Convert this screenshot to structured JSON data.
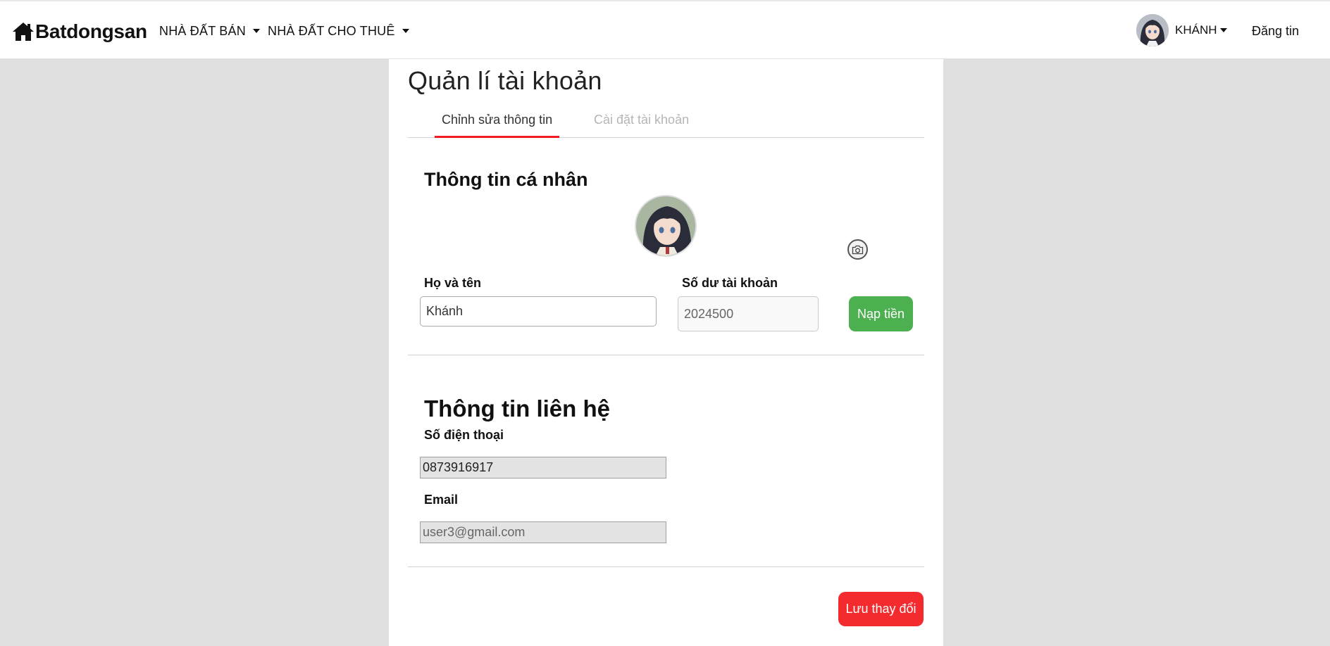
{
  "navbar": {
    "brand": "Batdongsan",
    "menu_sale": "NHÀ ĐẤT BÁN",
    "menu_rent": "NHÀ ĐẤT CHO THUÊ",
    "user_name": "KHÁNH",
    "post_label": "Đăng tin"
  },
  "page": {
    "title": "Quản lí tài khoản",
    "tabs": [
      {
        "label": "Chỉnh sửa thông tin",
        "active": true
      },
      {
        "label": "Cài đặt tài khoản",
        "active": false
      }
    ]
  },
  "personal": {
    "title": "Thông tin cá nhân",
    "name_label": "Họ và tên",
    "name_value": "Khánh",
    "balance_label": "Số dư tài khoản",
    "balance_value": "2024500",
    "topup_label": "Nạp tiền"
  },
  "contact": {
    "title": "Thông tin liên hệ",
    "phone_label": "Số điện thoại",
    "phone_value": "0873916917",
    "email_label": "Email",
    "email_value": "user3@gmail.com"
  },
  "actions": {
    "save_label": "Lưu thay đổi"
  },
  "colors": {
    "accent_red": "#ef1c25",
    "topup_green": "#4caf50",
    "save_red": "#f32a2e",
    "page_bg": "#e0e0e0"
  },
  "icons": {
    "home": "home-icon",
    "camera": "camera-icon",
    "caret": "caret-down-icon"
  }
}
